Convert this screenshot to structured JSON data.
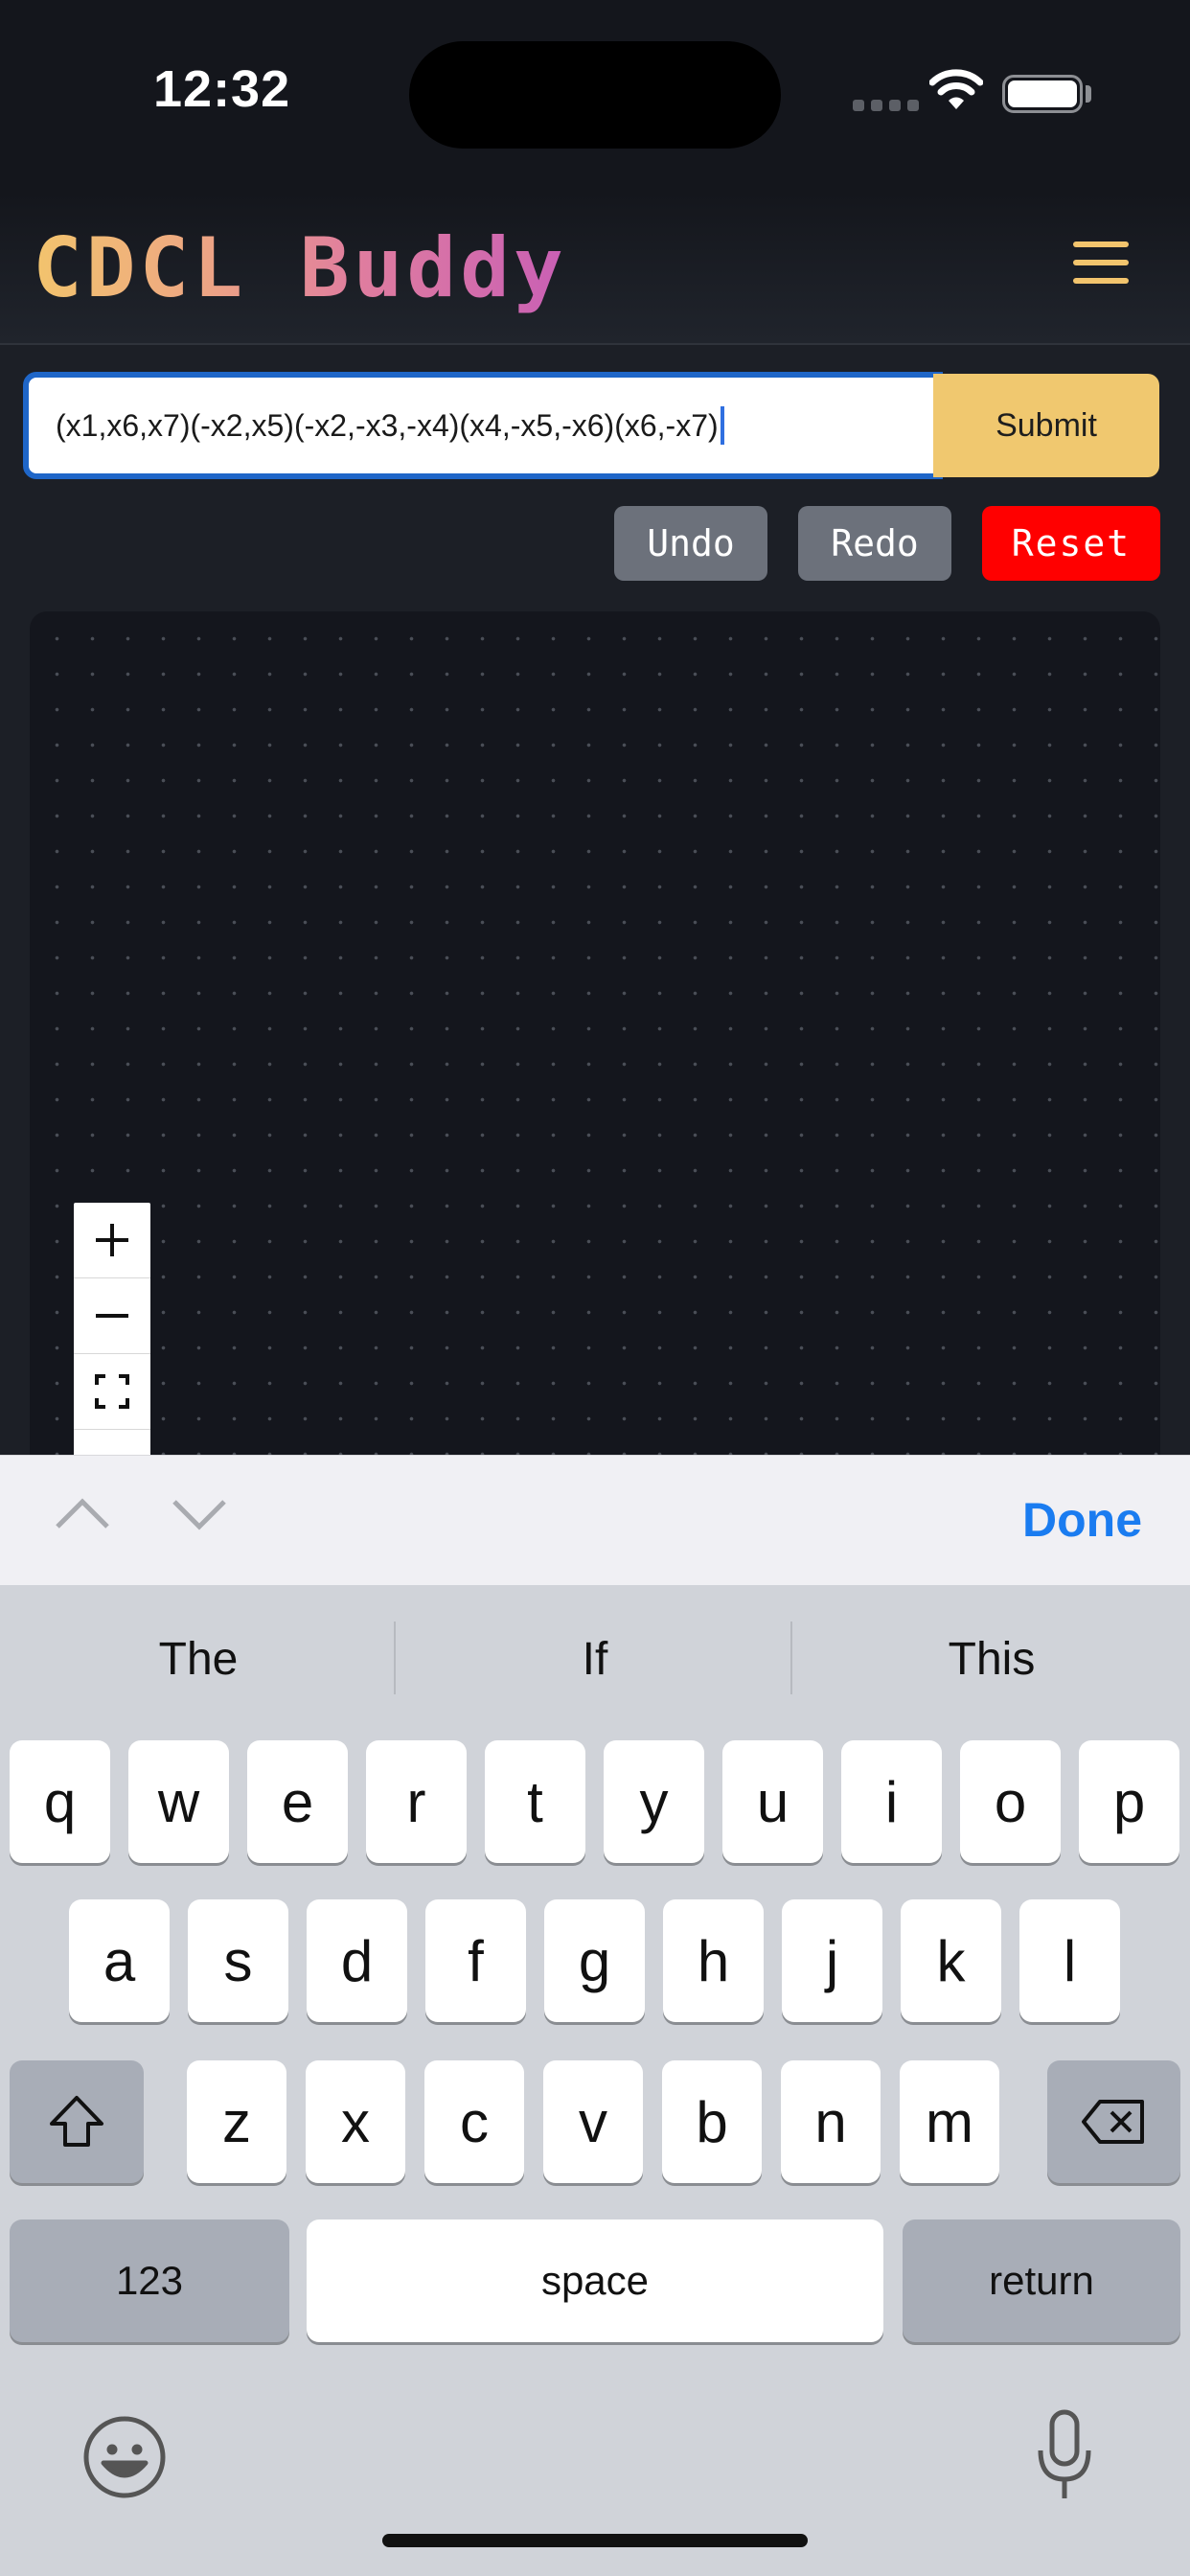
{
  "status_bar": {
    "time": "12:32",
    "icons": [
      "cellular-signal-icon",
      "wifi-icon",
      "battery-icon"
    ]
  },
  "header": {
    "title": "CDCL Buddy",
    "menu_icon": "hamburger-menu-icon",
    "title_gradient": [
      "#f2c46d",
      "#c95fb5"
    ]
  },
  "formula": {
    "value": "(x1,x6,x7)(-x2,x5)(-x2,-x3,-x4)(x4,-x5,-x6)(x6,-x7)",
    "submit_label": "Submit"
  },
  "controls": {
    "undo_label": "Undo",
    "redo_label": "Redo",
    "reset_label": "Reset"
  },
  "canvas": {
    "zoom_in_icon": "plus-icon",
    "zoom_out_icon": "minus-icon",
    "fit_view_icon": "fit-view-icon"
  },
  "keyboard_accessory": {
    "prev_icon": "chevron-up-icon",
    "next_icon": "chevron-down-icon",
    "done_label": "Done"
  },
  "keyboard": {
    "suggestions": [
      "The",
      "If",
      "This"
    ],
    "row1": [
      "q",
      "w",
      "e",
      "r",
      "t",
      "y",
      "u",
      "i",
      "o",
      "p"
    ],
    "row2": [
      "a",
      "s",
      "d",
      "f",
      "g",
      "h",
      "j",
      "k",
      "l"
    ],
    "row3": [
      "z",
      "x",
      "c",
      "v",
      "b",
      "n",
      "m"
    ],
    "numbers_label": "123",
    "space_label": "space",
    "return_label": "return"
  },
  "colors": {
    "accent_yellow": "#f0c86f",
    "reset_red": "#ff0000",
    "done_blue": "#1a7cf0",
    "input_border_blue": "#1f66c8"
  }
}
